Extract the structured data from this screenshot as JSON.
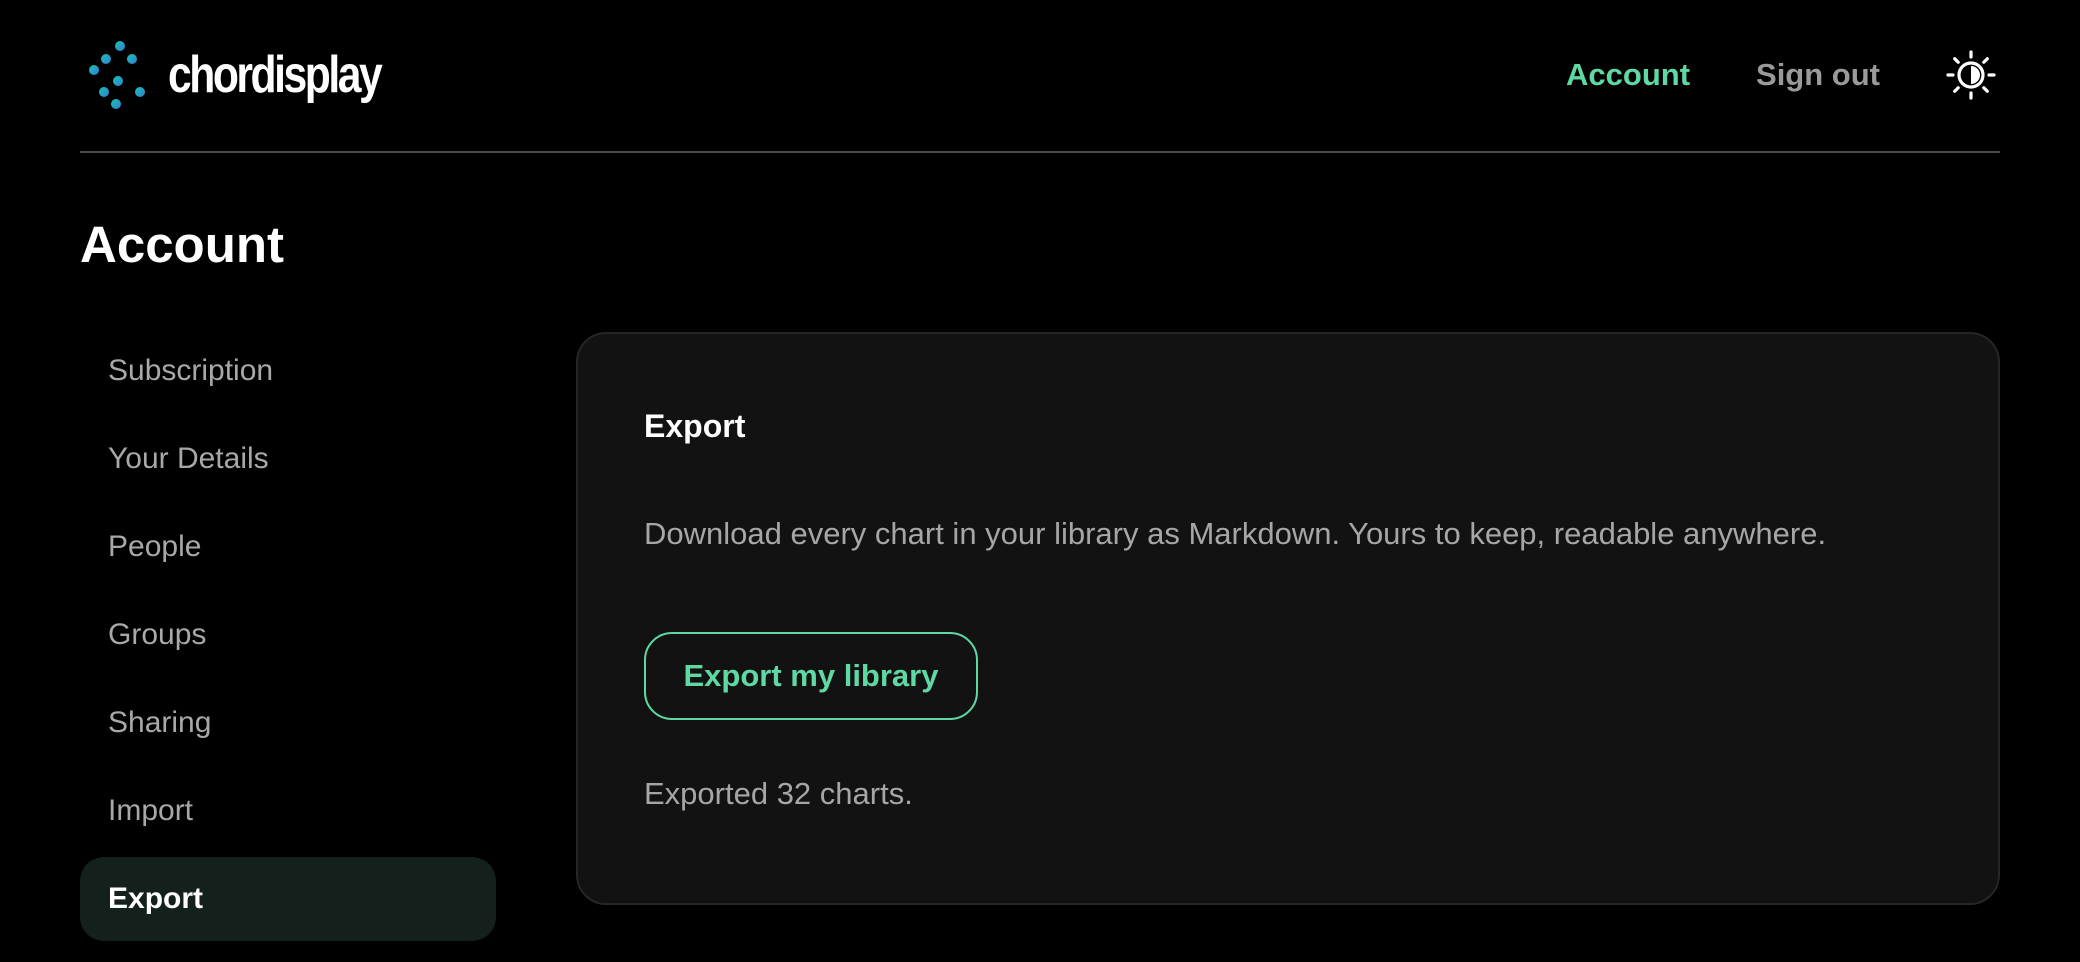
{
  "brand": {
    "name": "chordisplay",
    "icon": "equalizer-sliders-logo",
    "colors": {
      "teal": "#19b5b0",
      "blue": "#2f7fd4"
    }
  },
  "header": {
    "nav": {
      "account_label": "Account",
      "signout_label": "Sign out",
      "theme_toggle_icon": "sun-theme-icon"
    }
  },
  "page": {
    "title": "Account"
  },
  "sidebar": {
    "items": [
      {
        "label": "Subscription",
        "active": false
      },
      {
        "label": "Your Details",
        "active": false
      },
      {
        "label": "People",
        "active": false
      },
      {
        "label": "Groups",
        "active": false
      },
      {
        "label": "Sharing",
        "active": false
      },
      {
        "label": "Import",
        "active": false
      },
      {
        "label": "Export",
        "active": true
      }
    ]
  },
  "export_panel": {
    "title": "Export",
    "description": "Download every chart in your library as Markdown. Yours to keep, readable anywhere.",
    "button_label": "Export my library",
    "status": "Exported 32 charts."
  },
  "colors": {
    "accent": "#5fd9a4",
    "background": "#000000",
    "card": "#121212",
    "active_item_bg": "#13201b",
    "muted_text": "#a6a6a6"
  }
}
